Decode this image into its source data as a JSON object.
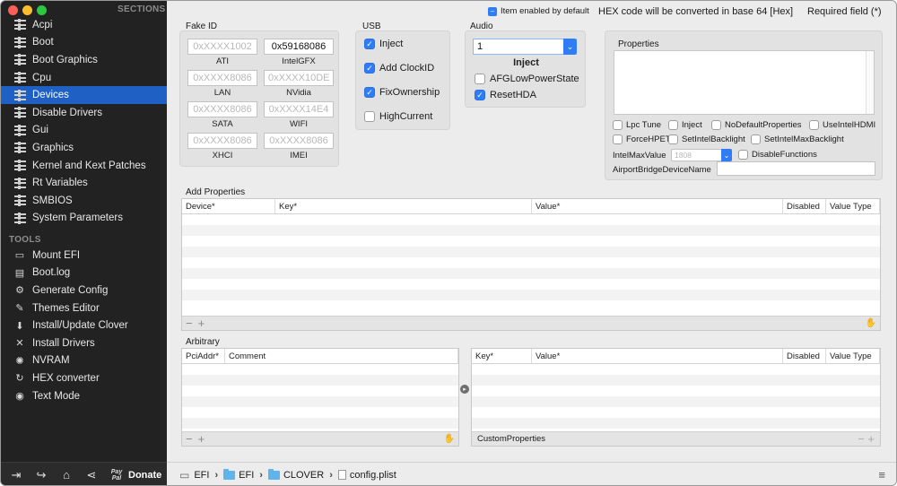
{
  "sidebar": {
    "sections_header": "SECTIONS",
    "tools_header": "TOOLS",
    "sections": [
      {
        "label": "Acpi",
        "icon": "list-icon"
      },
      {
        "label": "Boot",
        "icon": "list-icon"
      },
      {
        "label": "Boot Graphics",
        "icon": "list-icon"
      },
      {
        "label": "Cpu",
        "icon": "list-icon"
      },
      {
        "label": "Devices",
        "icon": "list-icon"
      },
      {
        "label": "Disable Drivers",
        "icon": "list-icon"
      },
      {
        "label": "Gui",
        "icon": "list-icon"
      },
      {
        "label": "Graphics",
        "icon": "list-icon"
      },
      {
        "label": "Kernel and Kext Patches",
        "icon": "list-icon"
      },
      {
        "label": "Rt Variables",
        "icon": "list-icon"
      },
      {
        "label": "SMBIOS",
        "icon": "list-icon"
      },
      {
        "label": "System Parameters",
        "icon": "list-icon"
      }
    ],
    "tools": [
      {
        "label": "Mount EFI",
        "icon": "drive-icon"
      },
      {
        "label": "Boot.log",
        "icon": "document-icon"
      },
      {
        "label": "Generate Config",
        "icon": "gear-icon"
      },
      {
        "label": "Themes Editor",
        "icon": "brush-icon"
      },
      {
        "label": "Install/Update Clover",
        "icon": "download-icon"
      },
      {
        "label": "Install Drivers",
        "icon": "tools-icon"
      },
      {
        "label": "NVRAM",
        "icon": "chip-icon"
      },
      {
        "label": "HEX converter",
        "icon": "refresh-icon"
      },
      {
        "label": "Text Mode",
        "icon": "eye-icon"
      }
    ],
    "footer": {
      "donate_label": "Donate",
      "paypal_label": "Pay Pal"
    }
  },
  "top_bar": {
    "enabled_default_label": "Item enabled by default",
    "hex_notice": "HEX code will be converted in base 64 [Hex]",
    "required_notice": "Required field (*)"
  },
  "fake_id": {
    "title": "Fake ID",
    "fields": [
      {
        "caption": "ATI",
        "value": "",
        "placeholder": "0xXXXX1002"
      },
      {
        "caption": "IntelGFX",
        "value": "0x59168086",
        "placeholder": ""
      },
      {
        "caption": "LAN",
        "value": "",
        "placeholder": "0xXXXX8086"
      },
      {
        "caption": "NVidia",
        "value": "",
        "placeholder": "0xXXXX10DE"
      },
      {
        "caption": "SATA",
        "value": "",
        "placeholder": "0xXXXX8086"
      },
      {
        "caption": "WIFI",
        "value": "",
        "placeholder": "0xXXXX14E4"
      },
      {
        "caption": "XHCI",
        "value": "",
        "placeholder": "0xXXXX8086"
      },
      {
        "caption": "IMEI",
        "value": "",
        "placeholder": "0xXXXX8086"
      }
    ]
  },
  "usb": {
    "title": "USB",
    "options": [
      {
        "label": "Inject",
        "checked": true
      },
      {
        "label": "Add ClockID",
        "checked": true
      },
      {
        "label": "FixOwnership",
        "checked": true
      },
      {
        "label": "HighCurrent",
        "checked": false
      }
    ]
  },
  "audio": {
    "title": "Audio",
    "inject_value": "1",
    "inject_label": "Inject",
    "options": [
      {
        "label": "AFGLowPowerState",
        "checked": false
      },
      {
        "label": "ResetHDA",
        "checked": true
      }
    ]
  },
  "properties": {
    "title": "Properties",
    "options": [
      {
        "label": "Lpc Tune",
        "checked": false
      },
      {
        "label": "Inject",
        "checked": false
      },
      {
        "label": "NoDefaultProperties",
        "checked": false
      },
      {
        "label": "UseIntelHDMI",
        "checked": false
      },
      {
        "label": "ForceHPET",
        "checked": false
      },
      {
        "label": "SetIntelBacklight",
        "checked": false
      },
      {
        "label": "SetIntelMaxBacklight",
        "checked": false
      }
    ],
    "intel_max_label": "IntelMaxValue",
    "intel_max_placeholder": "1808",
    "disable_functions_label": "DisableFunctions",
    "airport_label": "AirportBridgeDeviceName"
  },
  "add_properties": {
    "title": "Add Properties",
    "columns": [
      "Device*",
      "Key*",
      "Value*",
      "Disabled",
      "Value Type"
    ]
  },
  "arbitrary": {
    "title": "Arbitrary",
    "left_columns": [
      "PciAddr*",
      "Comment"
    ],
    "right_columns": [
      "Key*",
      "Value*",
      "Disabled",
      "Value Type"
    ],
    "custom_properties_label": "CustomProperties"
  },
  "path": {
    "segments": [
      "EFI",
      "EFI",
      "CLOVER",
      "config.plist"
    ]
  },
  "colors": {
    "sidebar_bg": "#222222",
    "selection": "#1f60c4",
    "checkbox_on": "#2f7df6"
  }
}
